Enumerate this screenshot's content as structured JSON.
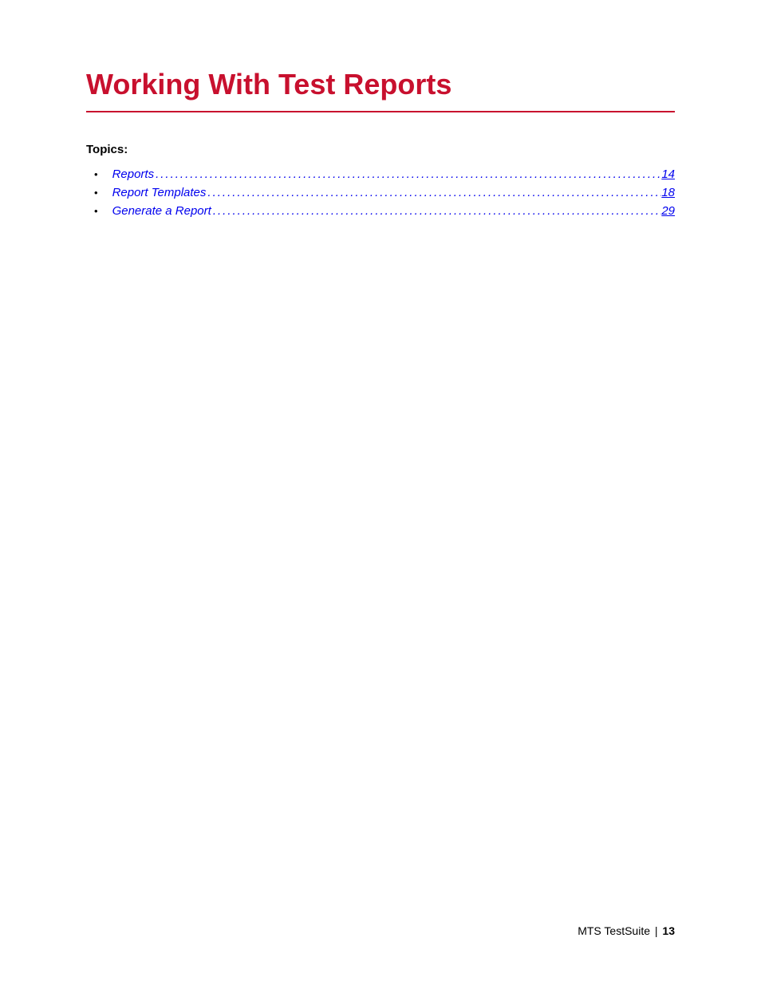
{
  "chapter": {
    "title": "Working With Test Reports"
  },
  "topics": {
    "label": "Topics:",
    "items": [
      {
        "title": "Reports",
        "page": "14"
      },
      {
        "title": "Report Templates",
        "page": "18"
      },
      {
        "title": "Generate a Report",
        "page": "29"
      }
    ]
  },
  "footer": {
    "product": "MTS TestSuite",
    "separator": "|",
    "page": "13"
  }
}
